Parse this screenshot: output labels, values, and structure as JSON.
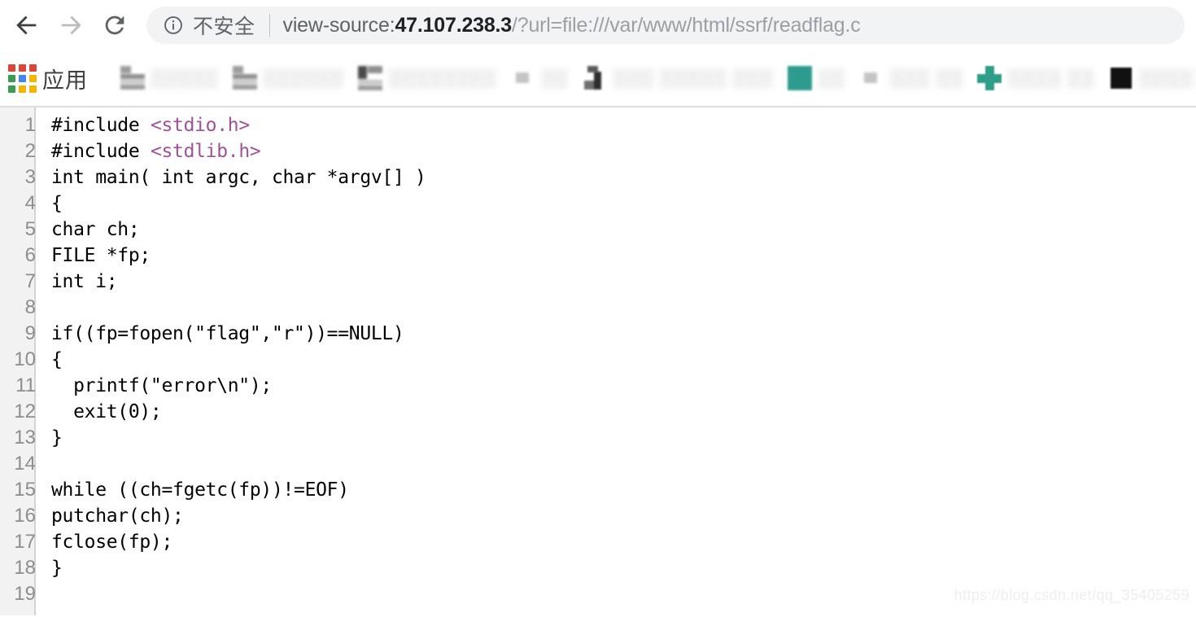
{
  "browser": {
    "toolbar": {
      "back_icon": "back-arrow-icon",
      "forward_icon": "forward-arrow-icon",
      "reload_icon": "reload-icon"
    },
    "omnibox": {
      "info_icon": "info-circle-icon",
      "security_label": "不安全",
      "url_full": "view-source:47.107.238.3/?url=file:///var/www/html/ssrf/readflag.c",
      "url_scheme": "view-source:",
      "url_host": "47.107.238.3",
      "url_path": "/?url=file:///var/www/html/ssrf/readflag.c"
    },
    "bookmarks_bar": {
      "apps_icon": "apps-grid-icon",
      "apps_label": "应用",
      "items": [
        {
          "label": "░░░░░",
          "icon": "doc"
        },
        {
          "label": "░░░░░░",
          "icon": "doc"
        },
        {
          "label": "░░░░░░░░",
          "icon": "dark"
        },
        {
          "label": "░░",
          "icon": "smallgray"
        },
        {
          "label": "░░░ ░░░░░ ░░░",
          "icon": "glyph"
        },
        {
          "label": "░░",
          "icon": "teal"
        },
        {
          "label": "░░░ ░░",
          "icon": "smallgray"
        },
        {
          "label": "░░░░ ░░",
          "icon": "cross"
        },
        {
          "label": "░░░░ ░░░",
          "icon": "blacknote"
        },
        {
          "label": "",
          "icon": "bluesq"
        }
      ]
    }
  },
  "source_view": {
    "lines": [
      {
        "n": "1",
        "pre": "#include ",
        "inc": "<stdio.h>",
        "post": ""
      },
      {
        "n": "2",
        "pre": "#include ",
        "inc": "<stdlib.h>",
        "post": ""
      },
      {
        "n": "3",
        "pre": "int main( int argc, char *argv[] )",
        "inc": "",
        "post": ""
      },
      {
        "n": "4",
        "pre": "{",
        "inc": "",
        "post": ""
      },
      {
        "n": "5",
        "pre": "char ch;",
        "inc": "",
        "post": ""
      },
      {
        "n": "6",
        "pre": "FILE *fp;",
        "inc": "",
        "post": ""
      },
      {
        "n": "7",
        "pre": "int i;",
        "inc": "",
        "post": ""
      },
      {
        "n": "8",
        "pre": "",
        "inc": "",
        "post": ""
      },
      {
        "n": "9",
        "pre": "if((fp=fopen(\"flag\",\"r\"))==NULL)",
        "inc": "",
        "post": ""
      },
      {
        "n": "10",
        "pre": "{",
        "inc": "",
        "post": ""
      },
      {
        "n": "11",
        "pre": "  printf(\"error\\n\");",
        "inc": "",
        "post": ""
      },
      {
        "n": "12",
        "pre": "  exit(0);",
        "inc": "",
        "post": ""
      },
      {
        "n": "13",
        "pre": "}",
        "inc": "",
        "post": ""
      },
      {
        "n": "14",
        "pre": "",
        "inc": "",
        "post": ""
      },
      {
        "n": "15",
        "pre": "while ((ch=fgetc(fp))!=EOF)",
        "inc": "",
        "post": ""
      },
      {
        "n": "16",
        "pre": "putchar(ch);",
        "inc": "",
        "post": ""
      },
      {
        "n": "17",
        "pre": "fclose(fp);",
        "inc": "",
        "post": ""
      },
      {
        "n": "18",
        "pre": "}",
        "inc": "",
        "post": ""
      },
      {
        "n": "19",
        "pre": "",
        "inc": "",
        "post": ""
      }
    ],
    "watermark": "https://blog.csdn.net/qq_35405259"
  },
  "colors": {
    "include_purple": "#a0519a",
    "omnibox_bg": "#f1f3f4",
    "gutter_bg": "#f2f2f2",
    "line_number": "#8d8d8d",
    "url_host": "#202124"
  }
}
